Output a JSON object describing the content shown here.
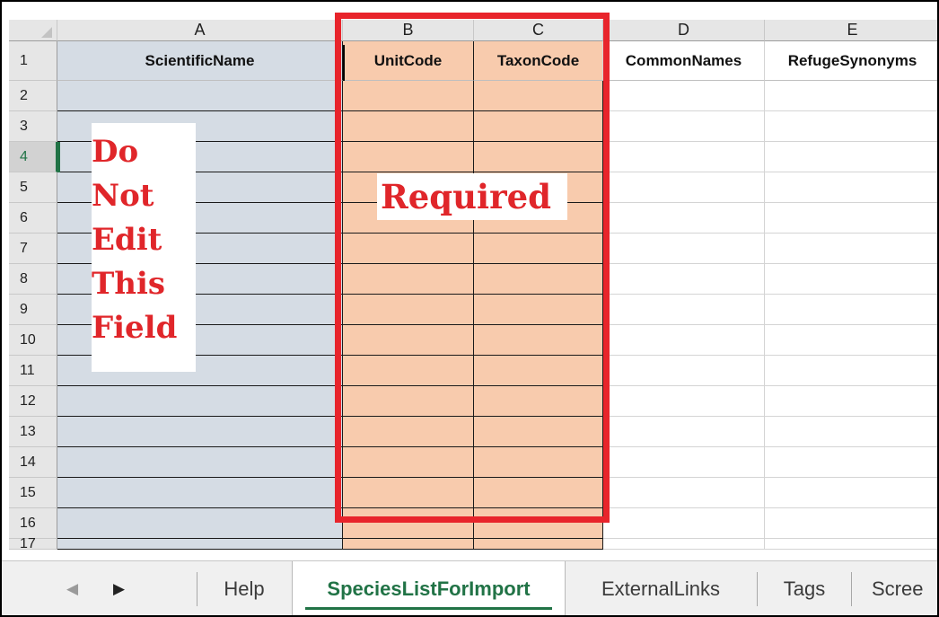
{
  "columns": [
    "A",
    "B",
    "C",
    "D",
    "E"
  ],
  "header_row": {
    "row_number": "1",
    "cells": [
      "ScientificName",
      "UnitCode",
      "TaxonCode",
      "CommonNames",
      "RefugeSynonyms"
    ]
  },
  "row_numbers": [
    "2",
    "3",
    "4",
    "5",
    "6",
    "7",
    "8",
    "9",
    "10",
    "11",
    "12",
    "13",
    "14",
    "15",
    "16",
    "17"
  ],
  "active_row": "4",
  "annotations": {
    "do_not_edit": [
      "Do",
      "Not",
      "Edit",
      "This",
      "Field"
    ],
    "required": "Required"
  },
  "tabs": {
    "items": [
      "Help",
      "SpeciesListForImport",
      "ExternalLinks",
      "Tags",
      "Scree"
    ],
    "active": "SpeciesListForImport"
  },
  "colors": {
    "columnA_fill": "#d5dce4",
    "required_fill": "#f8cbad",
    "annotation_red": "#e0262a",
    "box_red": "#e8242b",
    "excel_green": "#217346"
  }
}
